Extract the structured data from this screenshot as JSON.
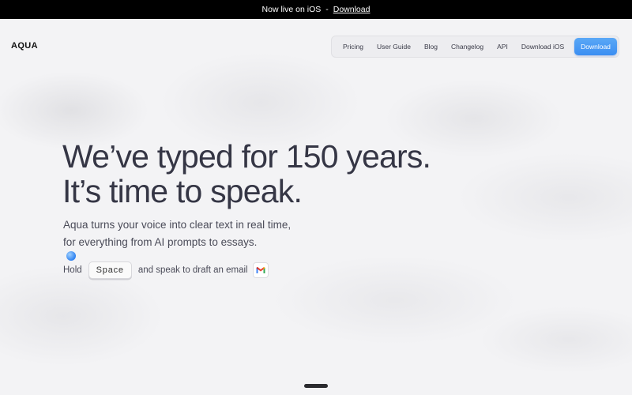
{
  "announcement": {
    "text": "Now live on iOS",
    "separator": "-",
    "link_label": "Download"
  },
  "nav": {
    "logo": "AQUA",
    "items": [
      {
        "label": "Pricing"
      },
      {
        "label": "User Guide"
      },
      {
        "label": "Blog"
      },
      {
        "label": "Changelog"
      },
      {
        "label": "API"
      },
      {
        "label": "Download iOS"
      }
    ],
    "cta_label": "Download"
  },
  "hero": {
    "headline_line1": "We’ve typed for 150 years.",
    "headline_line2": "It’s time to speak.",
    "sub_line1": "Aqua turns your voice into clear text in real time,",
    "sub_line2": "for everything from AI prompts to essays.",
    "hold_prefix": "Hold",
    "key_label": "Space",
    "hold_suffix": "and speak to draft an email",
    "app_icon": "gmail-icon"
  },
  "colors": {
    "accent": "#3b8ef2",
    "announce_bg": "#000000",
    "headline": "#353645"
  }
}
